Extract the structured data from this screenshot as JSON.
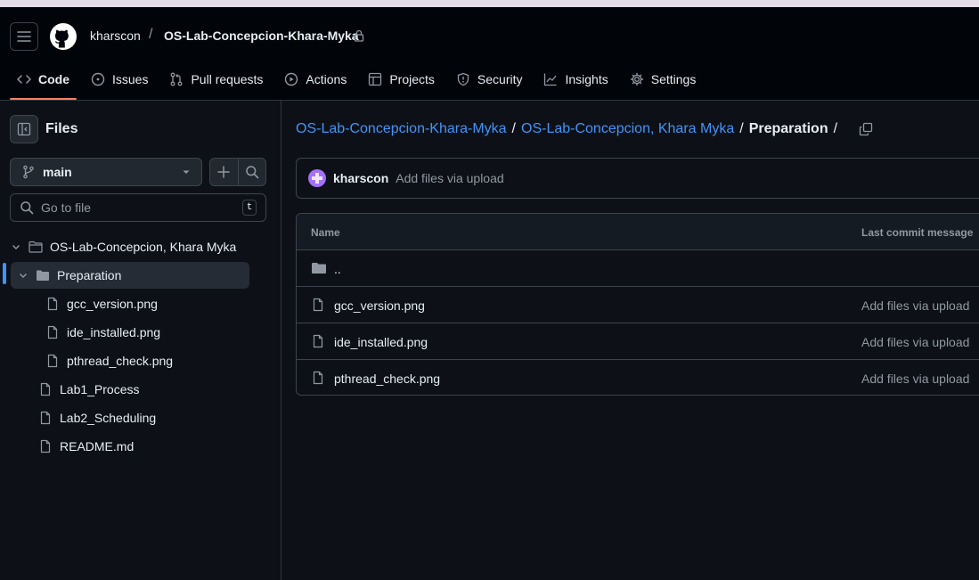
{
  "header": {
    "owner": "kharscon",
    "separator": "/",
    "repo": "OS-Lab-Concepcion-Khara-Myka",
    "nav": [
      {
        "label": "Code",
        "icon": "code-icon"
      },
      {
        "label": "Issues",
        "icon": "issue-icon"
      },
      {
        "label": "Pull requests",
        "icon": "pull-request-icon"
      },
      {
        "label": "Actions",
        "icon": "play-icon"
      },
      {
        "label": "Projects",
        "icon": "table-icon"
      },
      {
        "label": "Security",
        "icon": "shield-icon"
      },
      {
        "label": "Insights",
        "icon": "graph-icon"
      },
      {
        "label": "Settings",
        "icon": "gear-icon"
      }
    ]
  },
  "sidebar": {
    "title": "Files",
    "branch": "main",
    "search_placeholder": "Go to file",
    "search_shortcut": "t",
    "tree": [
      {
        "label": "OS-Lab-Concepcion, Khara Myka",
        "type": "folder"
      },
      {
        "label": "Preparation",
        "type": "folder"
      },
      {
        "label": "gcc_version.png",
        "type": "file"
      },
      {
        "label": "ide_installed.png",
        "type": "file"
      },
      {
        "label": "pthread_check.png",
        "type": "file"
      },
      {
        "label": "Lab1_Process",
        "type": "file"
      },
      {
        "label": "Lab2_Scheduling",
        "type": "file"
      },
      {
        "label": "README.md",
        "type": "file"
      }
    ]
  },
  "breadcrumb": {
    "repo": "OS-Lab-Concepcion-Khara-Myka",
    "folder": "OS-Lab-Concepcion, Khara Myka",
    "current": "Preparation",
    "sep": "/"
  },
  "commit": {
    "author": "kharscon",
    "message": "Add files via upload"
  },
  "table": {
    "headers": [
      "Name",
      "Last commit message"
    ],
    "rows": [
      {
        "name": "..",
        "message": ""
      },
      {
        "name": "gcc_version.png",
        "message": "Add files via upload"
      },
      {
        "name": "ide_installed.png",
        "message": "Add files via upload"
      },
      {
        "name": "pthread_check.png",
        "message": "Add files via upload"
      }
    ]
  }
}
